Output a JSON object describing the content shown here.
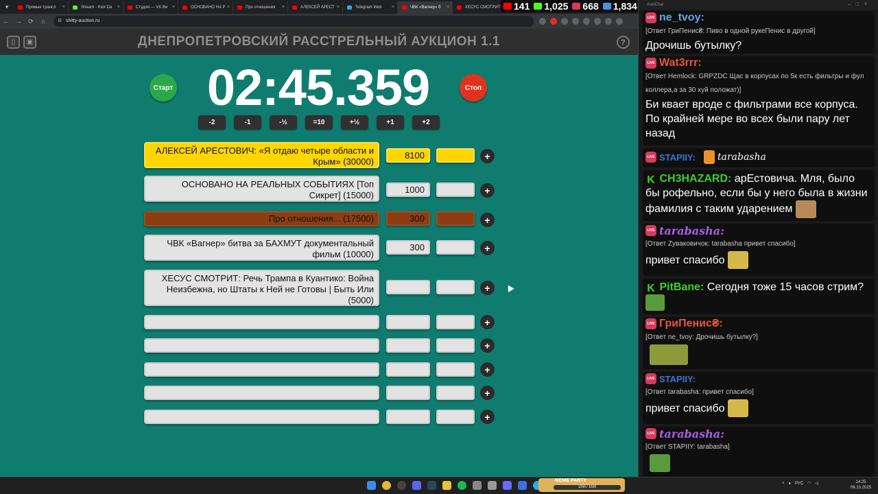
{
  "browser": {
    "tabs": [
      {
        "label": "Прямые трансл",
        "favicon_color": "#ff0000"
      },
      {
        "label": "Stream - Kick Da",
        "favicon_color": "#53fc18"
      },
      {
        "label": "Студия — VK Ви",
        "favicon_color": "#ff0000"
      },
      {
        "label": "ОСНОВАНО НА Р",
        "favicon_color": "#ff0000"
      },
      {
        "label": "Про отношения",
        "favicon_color": "#ff0000"
      },
      {
        "label": "АЛЕКСЕЙ АРЕСТ",
        "favicon_color": "#ff0000"
      },
      {
        "label": "Telegram Web",
        "favicon_color": "#2aabee"
      },
      {
        "label": "ЧВК «Вагнер» б",
        "favicon_color": "#ff0000"
      },
      {
        "label": "ХЕСУС СМОТРИТ",
        "favicon_color": "#ff0000"
      }
    ],
    "url": "shitty-auction.ru",
    "close_glyph": "×",
    "icons": {
      "tab_menu": "chevron-down-icon",
      "back": "back-arrow-icon",
      "forward": "forward-arrow-icon",
      "reload": "reload-icon",
      "home": "home-icon",
      "site_info": "tune-icon",
      "star": "star-icon"
    }
  },
  "stream_stats": {
    "youtube_viewers": "141",
    "kick_viewers": "1,025",
    "vk_viewers": "668",
    "total_viewers": "1,834"
  },
  "auction": {
    "title": "ДНЕПРОПЕТРОВСКИЙ РАССТРЕЛЬНЫЙ АУКЦИОН 1.1",
    "timer": "02:45.359",
    "start_label": "Старт",
    "stop_label": "Стоп",
    "help_glyph": "?",
    "adjust_buttons": [
      "-2",
      "-1",
      "-½",
      "=10",
      "+½",
      "+1",
      "+2"
    ],
    "add_glyph": "+",
    "lots": [
      {
        "name": "АЛЕКСЕЙ АРЕСТОВИЧ: «Я отдаю четыре области и Крым» (30000)",
        "amount": "8100"
      },
      {
        "name": "ОСНОВАНО НА РЕАЛЬНЫХ СОБЫТИЯХ [Топ Сикрет] (15000)",
        "amount": "1000"
      },
      {
        "name": "Про отношения... (17500)",
        "amount": "300"
      },
      {
        "name": "ЧВК «Вагнер» битва за БАХМУТ документальный фильм (10000)",
        "amount": "300"
      },
      {
        "name": "ХЕСУС СМОТРИТ: Речь Трампа в Куантико: Война Неизбежна, но Штаты к Ней не Готовы | Быть Или (5000)",
        "amount": ""
      },
      {
        "name": "",
        "amount": ""
      },
      {
        "name": "",
        "amount": ""
      },
      {
        "name": "",
        "amount": ""
      },
      {
        "name": "",
        "amount": ""
      },
      {
        "name": "",
        "amount": ""
      }
    ],
    "colors": {
      "background": "#107c70",
      "leader": "#ffd600",
      "third": "#8c3e12",
      "start": "#2ba84a",
      "stop": "#e0331d"
    }
  },
  "chat": {
    "window_title": "AxelChat",
    "platform_badge": "LIVE",
    "kick_glyph": "K",
    "messages": [
      {
        "platform": "vk",
        "author": "ne_tvoy:",
        "color": "#5fa8e8",
        "reply": "[Ответ ГриПенис₴: Пиво в одной рукеПенис в другой]",
        "text": "Дрочишь бутылку?"
      },
      {
        "platform": "vk",
        "author": "Wat3rrr:",
        "color": "#e8573c",
        "reply": "[Ответ Hemlock: GRPZDC Щас в корпусах по 5к есть фильтры и фул коллера,а за 30 хуй положат)]",
        "text": "Би квает вроде с фильтрами все корпуса. По крайней мере во всех были пару лет назад"
      },
      {
        "platform": "vk",
        "author": "STAPIIY:",
        "color": "#3c74d8",
        "reply": "",
        "text": "tarabasha"
      },
      {
        "platform": "kick",
        "author": "CH3HAZARD:",
        "color": "#3bd02c",
        "reply": "",
        "text": "арЕстовича. Мля, было бы рофельно, если бы у него была в жизни фамилия с таким ударением"
      },
      {
        "platform": "vk",
        "author": "tarabasha:",
        "color": "#a95ee8",
        "reply": "[Ответ Zуваковичок: tarabasha привет спасибо]",
        "text": "привет спасибо"
      },
      {
        "platform": "kick",
        "author": "PitBane:",
        "color": "#3bd02c",
        "reply": "",
        "text": "Сегодня тоже 15 часов стрим?"
      },
      {
        "platform": "vk",
        "author": "ГриПенис₴:",
        "color": "#e8573c",
        "reply": "[Ответ ne_tvoy: Дрочишь бутылку?]",
        "text": ""
      },
      {
        "platform": "vk",
        "author": "STAPIIY:",
        "color": "#3c74d8",
        "reply": "[Ответ tarabasha: привет спасибо]",
        "text": "привет спасибо"
      },
      {
        "platform": "vk",
        "author": "tarabasha:",
        "color": "#a95ee8",
        "reply": "[Ответ STAPIIY: tarabasha]",
        "text": ""
      }
    ]
  },
  "taskbar": {
    "meme_title": "MEME PARTY",
    "meme_progress": "1250 / 1500",
    "lang": "РУС",
    "time": "14:25",
    "date": "06.10.2025"
  }
}
